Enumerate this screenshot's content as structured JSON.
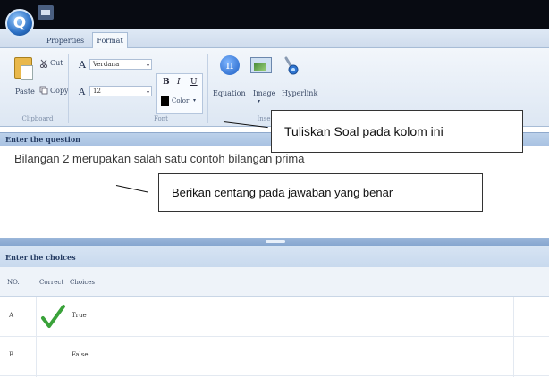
{
  "titlebar": {
    "app_icon_letter": "Q"
  },
  "tabs": [
    {
      "label": "Properties",
      "active": false
    },
    {
      "label": "Format",
      "active": true
    }
  ],
  "ribbon": {
    "clipboard": {
      "paste_label": "Paste",
      "cut_label": "Cut",
      "copy_label": "Copy",
      "caption": "Clipboard"
    },
    "font": {
      "font_family_value": "Verdana",
      "font_size_value": "12",
      "bold_label": "B",
      "italic_label": "I",
      "underline_label": "U",
      "color_label": "Color",
      "caption": "Font"
    },
    "insert": {
      "equation_label": "Equation",
      "image_label": "Image",
      "hyperlink_label": "Hyperlink",
      "caption_partial": "Inse"
    }
  },
  "question": {
    "header": "Enter the question",
    "text": "Bilangan 2 merupakan salah satu contoh bilangan prima"
  },
  "choices": {
    "header": "Enter the choices",
    "columns": [
      "NO.",
      "Correct",
      "Choices"
    ],
    "rows": [
      {
        "no": "A",
        "correct": true,
        "choice": "True"
      },
      {
        "no": "B",
        "correct": false,
        "choice": "False"
      }
    ]
  },
  "annotations": {
    "callout_1": "Tuliskan Soal pada kolom ini",
    "callout_2": "Berikan centang pada jawaban yang benar"
  },
  "colors": {
    "accent": "#2a6fc4",
    "checkmark": "#3aa23a"
  }
}
